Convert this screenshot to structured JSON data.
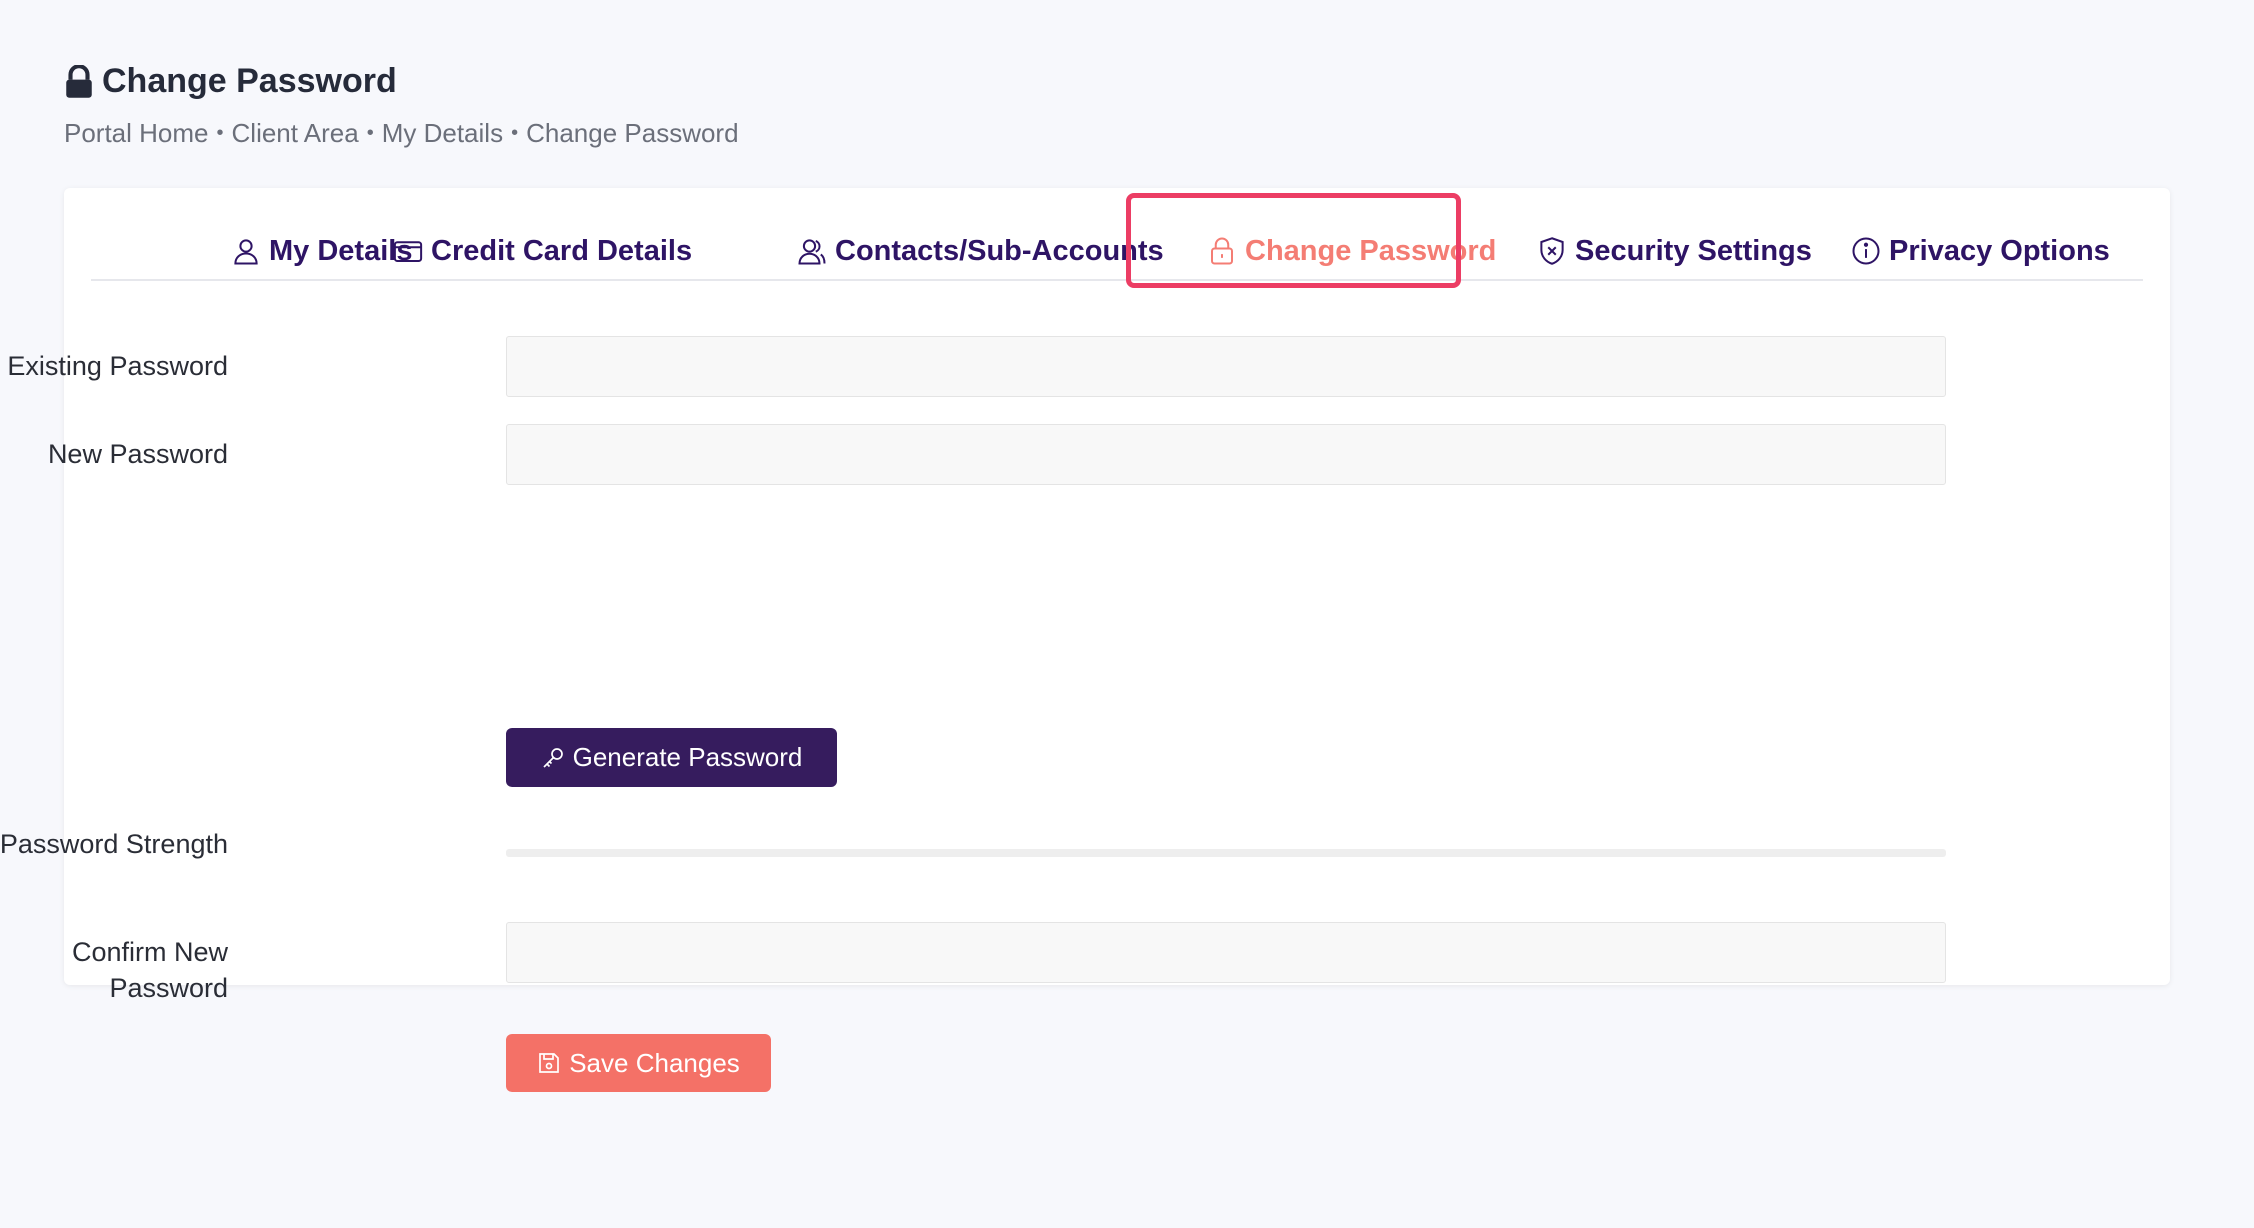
{
  "header": {
    "title": "Change Password",
    "title_icon": "lock-icon"
  },
  "breadcrumb": {
    "items": [
      "Portal Home",
      "Client Area",
      "My Details",
      "Change Password"
    ],
    "separator": "•"
  },
  "tabs": [
    {
      "label": "My Details",
      "icon": "user-icon",
      "active": false
    },
    {
      "label": "Credit Card Details",
      "icon": "credit-card-icon",
      "active": false
    },
    {
      "label": "Contacts/Sub-Accounts",
      "icon": "users-icon",
      "active": false
    },
    {
      "label": "Change Password",
      "icon": "lock-icon",
      "active": true
    },
    {
      "label": "Security Settings",
      "icon": "shield-icon",
      "active": false
    },
    {
      "label": "Privacy Options",
      "icon": "info-icon",
      "active": false
    }
  ],
  "form": {
    "existing_password_label": "Existing Password",
    "existing_password_value": "",
    "new_password_label": "New Password",
    "new_password_value": "",
    "generate_button_label": "Generate Password",
    "password_strength_label": "Password Strength",
    "password_strength_value": 0,
    "confirm_password_label_line1": "Confirm New",
    "confirm_password_label_line2": "Password",
    "confirm_password_value": "",
    "save_button_label": "Save Changes"
  },
  "colors": {
    "primary": "#361c5e",
    "tab_text": "#2e1465",
    "accent": "#f47167",
    "active_tab": "#f47d74",
    "highlight_frame": "#ec3d64",
    "background": "#f7f8fc"
  }
}
